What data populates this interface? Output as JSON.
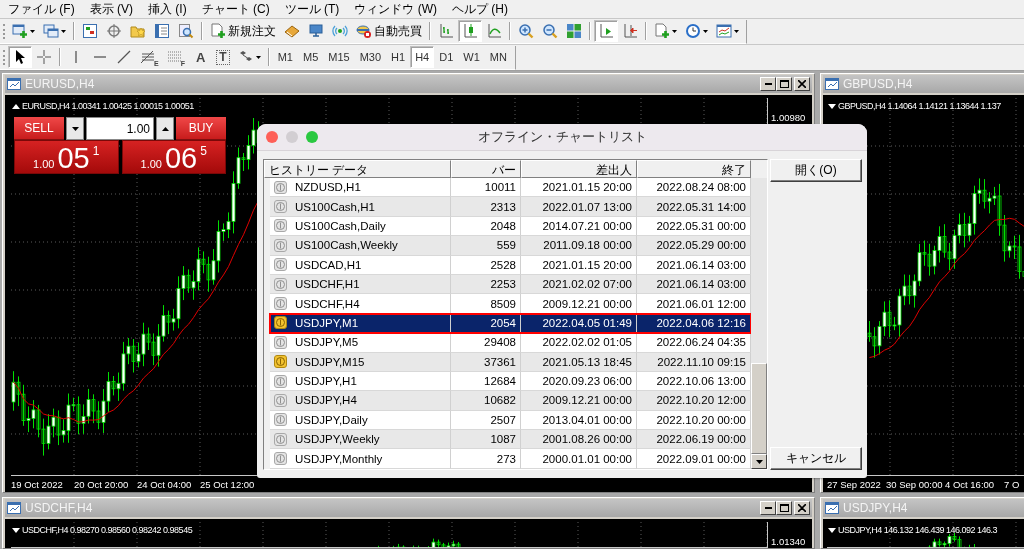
{
  "menu": [
    "ファイル (F)",
    "表示 (V)",
    "挿入 (I)",
    "チャート (C)",
    "ツール (T)",
    "ウィンドウ (W)",
    "ヘルプ (H)"
  ],
  "main_toolbar": [
    {
      "kind": "new-chart"
    },
    {
      "kind": "profiles"
    },
    {
      "kind": "separator"
    },
    {
      "kind": "market-watch"
    },
    {
      "kind": "data-window"
    },
    {
      "kind": "navigator"
    },
    {
      "kind": "terminal"
    },
    {
      "kind": "tester"
    },
    {
      "kind": "separator"
    },
    {
      "kind": "new-order",
      "label": "新規注文"
    },
    {
      "kind": "editor"
    },
    {
      "kind": "community"
    },
    {
      "kind": "signals"
    },
    {
      "kind": "auto-trading",
      "label": "自動売買"
    },
    {
      "kind": "separator"
    },
    {
      "kind": "bar-chart",
      "selected": false
    },
    {
      "kind": "candles",
      "selected": true
    },
    {
      "kind": "line-chart",
      "selected": false
    },
    {
      "kind": "separator"
    },
    {
      "kind": "zoom-in"
    },
    {
      "kind": "zoom-out"
    },
    {
      "kind": "tile"
    },
    {
      "kind": "separator"
    },
    {
      "kind": "autoscroll",
      "on": true
    },
    {
      "kind": "chart-shift",
      "on": false
    },
    {
      "kind": "separator"
    },
    {
      "kind": "indicators"
    },
    {
      "kind": "periods"
    },
    {
      "kind": "templates"
    }
  ],
  "drawing_toolbar": [
    {
      "kind": "cursor",
      "selected": true
    },
    {
      "kind": "crosshair",
      "selected": false
    },
    {
      "kind": "separator"
    },
    {
      "kind": "vline",
      "selected": false
    },
    {
      "kind": "hline",
      "selected": false
    },
    {
      "kind": "trendline",
      "selected": false
    },
    {
      "kind": "fibo",
      "letter": "E",
      "selected": false
    },
    {
      "kind": "fibo-lines",
      "letter": "F",
      "selected": false
    },
    {
      "kind": "text",
      "letter": "A",
      "selected": false
    },
    {
      "kind": "label",
      "letter": "T",
      "selected": false
    },
    {
      "kind": "arrows",
      "selected": false
    }
  ],
  "periods": [
    {
      "label": "M1",
      "selected": false
    },
    {
      "label": "M5",
      "selected": false
    },
    {
      "label": "M15",
      "selected": false
    },
    {
      "label": "M30",
      "selected": false
    },
    {
      "label": "H1",
      "selected": false
    },
    {
      "label": "H4",
      "selected": true
    },
    {
      "label": "D1",
      "selected": false
    },
    {
      "label": "W1",
      "selected": false
    },
    {
      "label": "MN",
      "selected": false
    }
  ],
  "charts": [
    {
      "title": "EURUSD,H4",
      "window_buttons": true,
      "panel_expanded": true,
      "info": "EURUSD,H4 1.00341 1.00425 1.00015 1.00051",
      "trade_panel": {
        "sell_label": "SELL",
        "buy_label": "BUY",
        "volume": "1.00",
        "sell_quote": {
          "lot": "1.00",
          "pips": "05",
          "point": "1"
        },
        "buy_quote": {
          "lot": "1.00",
          "pips": "06",
          "point": "5"
        }
      },
      "price_labels": [
        "1.00980"
      ],
      "time_labels": [
        "19 Oct 2022",
        "20 Oct 20:00",
        "24 Oct 04:00",
        "25 Oct 12:00"
      ]
    },
    {
      "title": "GBPUSD,H4",
      "window_buttons": false,
      "panel_expanded": false,
      "info": "GBPUSD,H4 1.14064 1.14121 1.13644 1.137",
      "time_labels": [
        "27 Sep 2022",
        "30 Sep 00:00",
        "4 Oct 16:00",
        "7 O"
      ]
    },
    {
      "title": "USDCHF,H4",
      "window_buttons": true,
      "panel_expanded": false,
      "info": "USDCHF,H4 0.98270 0.98560 0.98242 0.98545",
      "price_labels": [
        "1.01340"
      ]
    },
    {
      "title": "USDJPY,H4",
      "window_buttons": false,
      "panel_expanded": false,
      "info": "USDJPY,H4 146.132 146.439 146.092 146.3"
    }
  ],
  "dialog": {
    "title": "オフライン・チャートリスト",
    "columns": [
      "ヒストリー データ",
      "バー",
      "差出人",
      "終了"
    ],
    "rows": [
      {
        "name": "NZDUSD,H1",
        "bars": "10011",
        "from": "2021.01.15 20:00",
        "to": "2022.08.24 08:00",
        "active": false,
        "selected": false
      },
      {
        "name": "US100Cash,H1",
        "bars": "2313",
        "from": "2022.01.07 13:00",
        "to": "2022.05.31 14:00",
        "active": false,
        "selected": false
      },
      {
        "name": "US100Cash,Daily",
        "bars": "2048",
        "from": "2014.07.21 00:00",
        "to": "2022.05.31 00:00",
        "active": false,
        "selected": false
      },
      {
        "name": "US100Cash,Weekly",
        "bars": "559",
        "from": "2011.09.18 00:00",
        "to": "2022.05.29 00:00",
        "active": false,
        "selected": false
      },
      {
        "name": "USDCAD,H1",
        "bars": "2528",
        "from": "2021.01.15 20:00",
        "to": "2021.06.14 03:00",
        "active": false,
        "selected": false
      },
      {
        "name": "USDCHF,H1",
        "bars": "2253",
        "from": "2021.02.02 07:00",
        "to": "2021.06.14 03:00",
        "active": false,
        "selected": false
      },
      {
        "name": "USDCHF,H4",
        "bars": "8509",
        "from": "2009.12.21 00:00",
        "to": "2021.06.01 12:00",
        "active": false,
        "selected": false
      },
      {
        "name": "USDJPY,M1",
        "bars": "2054",
        "from": "2022.04.05 01:49",
        "to": "2022.04.06 12:16",
        "active": true,
        "selected": true
      },
      {
        "name": "USDJPY,M5",
        "bars": "29408",
        "from": "2022.02.02 01:05",
        "to": "2022.06.24 04:35",
        "active": false,
        "selected": false
      },
      {
        "name": "USDJPY,M15",
        "bars": "37361",
        "from": "2021.05.13 18:45",
        "to": "2022.11.10 09:15",
        "active": true,
        "selected": false
      },
      {
        "name": "USDJPY,H1",
        "bars": "12684",
        "from": "2020.09.23 06:00",
        "to": "2022.10.06 13:00",
        "active": false,
        "selected": false
      },
      {
        "name": "USDJPY,H4",
        "bars": "10682",
        "from": "2009.12.21 00:00",
        "to": "2022.10.20 12:00",
        "active": false,
        "selected": false
      },
      {
        "name": "USDJPY,Daily",
        "bars": "2507",
        "from": "2013.04.01 00:00",
        "to": "2022.10.20 00:00",
        "active": false,
        "selected": false
      },
      {
        "name": "USDJPY,Weekly",
        "bars": "1087",
        "from": "2001.08.26 00:00",
        "to": "2022.06.19 00:00",
        "active": false,
        "selected": false
      },
      {
        "name": "USDJPY,Monthly",
        "bars": "273",
        "from": "2000.01.01 00:00",
        "to": "2022.09.01 00:00",
        "active": false,
        "selected": false
      }
    ],
    "buttons": [
      "開く(O)",
      "キャンセル"
    ]
  }
}
